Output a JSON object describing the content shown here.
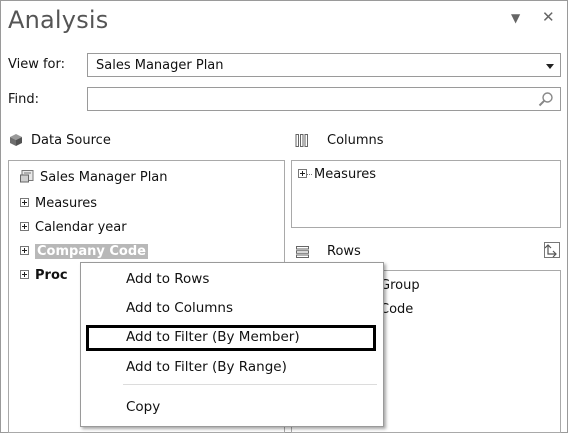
{
  "window": {
    "title": "Analysis",
    "dropdown_glyph": "▼",
    "close_glyph": "✕"
  },
  "view_for": {
    "label": "View for:",
    "value": "Sales Manager Plan"
  },
  "find": {
    "label": "Find:",
    "value": "",
    "placeholder": ""
  },
  "data_source": {
    "header": "Data Source",
    "root": "Sales Manager Plan",
    "items": [
      {
        "label": "Measures",
        "bold": false
      },
      {
        "label": "Calendar year",
        "bold": false
      },
      {
        "label": "Company Code",
        "bold": true,
        "selected": true
      },
      {
        "label": "Proc",
        "bold": true
      }
    ]
  },
  "columns": {
    "header": "Columns",
    "items": [
      "Measures"
    ]
  },
  "rows": {
    "header": "Rows",
    "items_partial": [
      "Group",
      "Code"
    ]
  },
  "context_menu": {
    "items": [
      "Add to Rows",
      "Add to Columns",
      "Add to Filter (By Member)",
      "Add to Filter (By Range)",
      "Copy"
    ],
    "highlighted_index": 2
  }
}
